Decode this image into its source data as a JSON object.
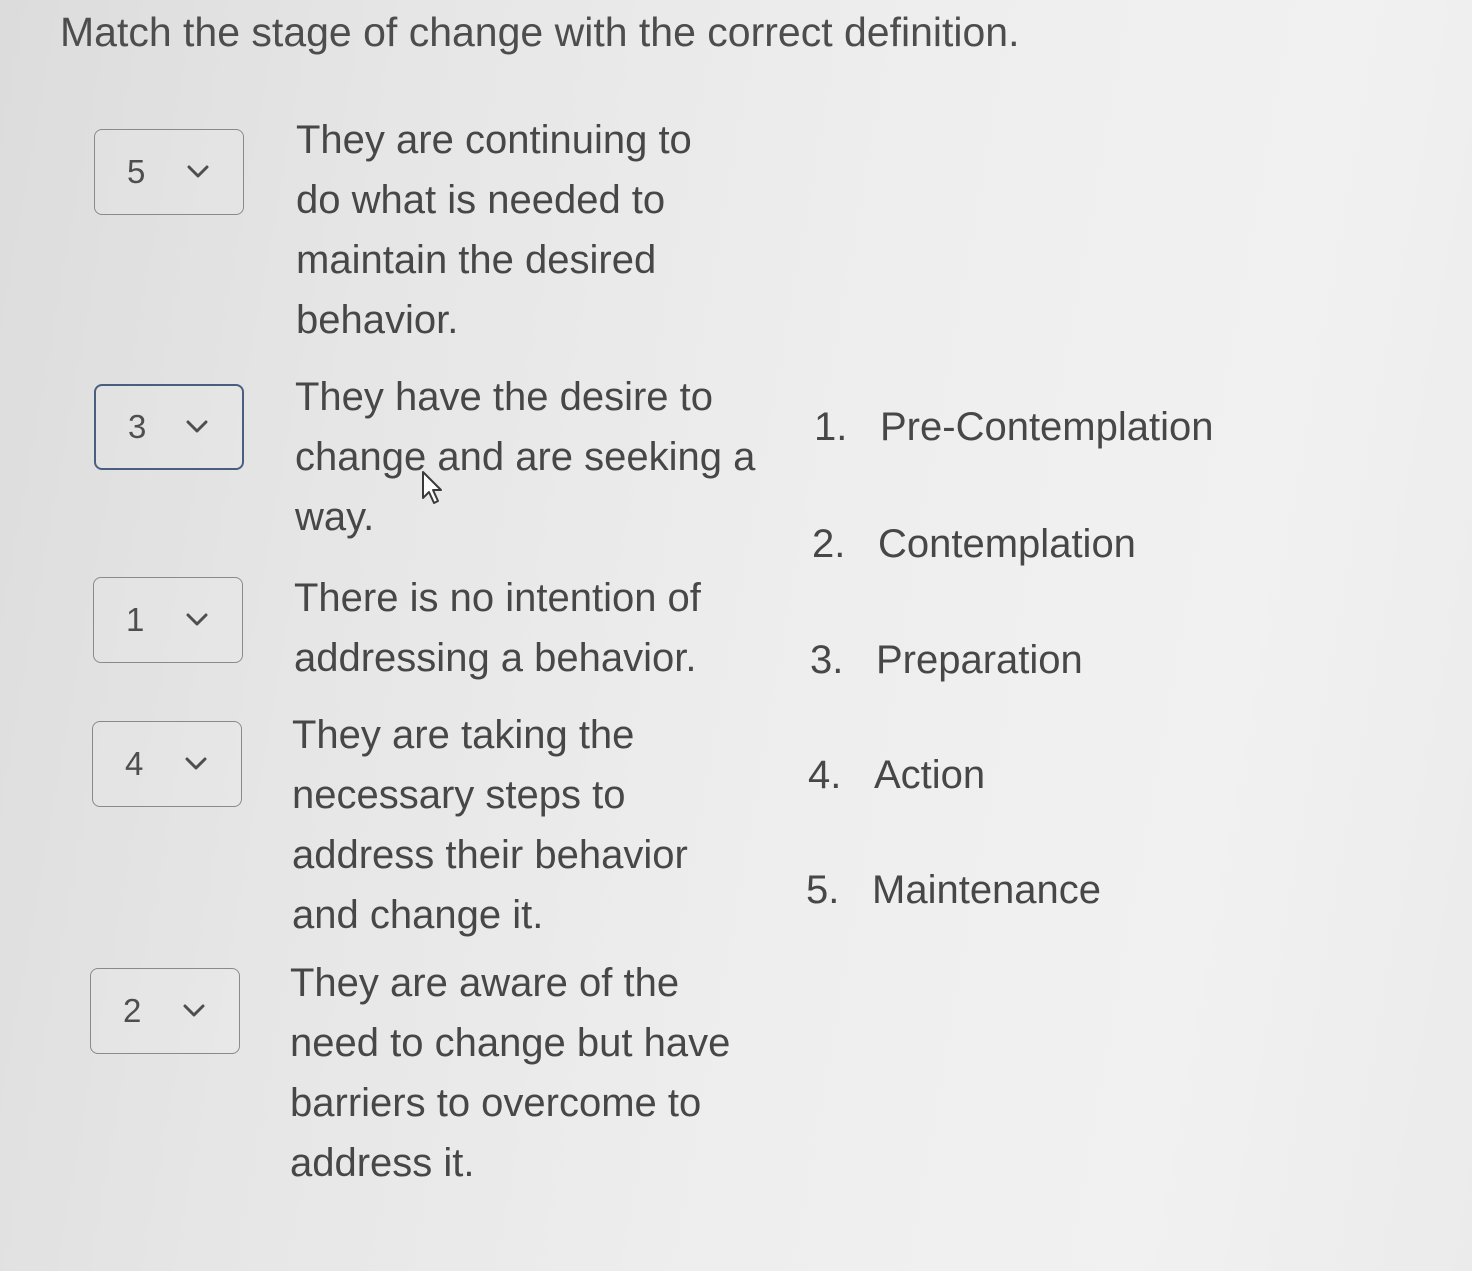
{
  "question": {
    "title": "Match the stage of change with the correct definition."
  },
  "matches": [
    {
      "selected": "5",
      "definition": "They are continuing to do what is needed to maintain the desired behavior."
    },
    {
      "selected": "3",
      "definition": "They have the desire to change and are seeking a way."
    },
    {
      "selected": "1",
      "definition": "There is no intention of addressing a behavior."
    },
    {
      "selected": "4",
      "definition": "They are taking the necessary steps to address their behavior and change it."
    },
    {
      "selected": "2",
      "definition": "They are aware of the need to change but have barriers to overcome to address it."
    }
  ],
  "stages": [
    {
      "number": "1.",
      "label": "Pre-Contemplation"
    },
    {
      "number": "2.",
      "label": "Contemplation"
    },
    {
      "number": "3.",
      "label": "Preparation"
    },
    {
      "number": "4.",
      "label": "Action"
    },
    {
      "number": "5.",
      "label": "Maintenance"
    }
  ],
  "icons": {
    "dropdown": "chevron-down-icon",
    "pointer": "mouse-cursor-icon"
  },
  "colors": {
    "focused_border": "#4a5f80",
    "border": "#8a8a8a",
    "text": "#474747"
  }
}
